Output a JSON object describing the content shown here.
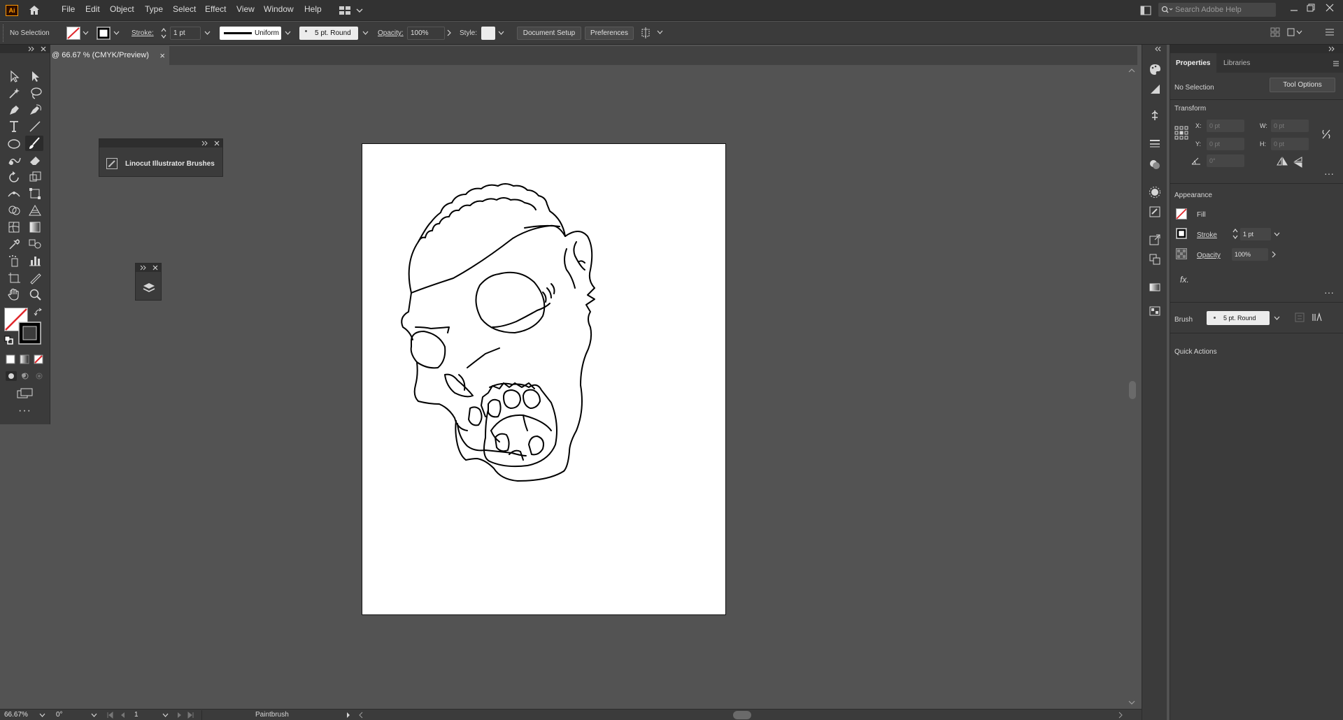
{
  "app": {
    "logo_text": "Ai",
    "menu": [
      "File",
      "Edit",
      "Object",
      "Type",
      "Select",
      "Effect",
      "View",
      "Window",
      "Help"
    ],
    "search_placeholder": "Search Adobe Help"
  },
  "controlbar": {
    "selection": "No Selection",
    "stroke_label": "Stroke:",
    "stroke_value": "1 pt",
    "profile": "Uniform",
    "brush": "5 pt. Round",
    "opacity_label": "Opacity:",
    "opacity_value": "100%",
    "style_label": "Style:",
    "document_setup": "Document Setup",
    "preferences": "Preferences"
  },
  "document_tab": {
    "title": "@ 66.67 % (CMYK/Preview)",
    "close": "×"
  },
  "brushes_panel": {
    "label": "Linocut Illustrator Brushes"
  },
  "properties": {
    "tab_properties": "Properties",
    "tab_libraries": "Libraries",
    "selection": "No Selection",
    "tool_options": "Tool Options",
    "transform_title": "Transform",
    "x_label": "X:",
    "y_label": "Y:",
    "w_label": "W:",
    "h_label": "H:",
    "x_value": "0 pt",
    "y_value": "0 pt",
    "w_value": "0 pt",
    "h_value": "0 pt",
    "angle_value": "0°",
    "appearance_title": "Appearance",
    "fill_label": "Fill",
    "stroke_label": "Stroke",
    "stroke_value": "1 pt",
    "opacity_label": "Opacity",
    "opacity_value": "100%",
    "fx_label": "fx.",
    "brush_label": "Brush",
    "brush_value": "5 pt. Round",
    "quick_actions": "Quick Actions"
  },
  "statusbar": {
    "zoom": "66.67%",
    "rotation": "0°",
    "artboard": "1",
    "tool": "Paintbrush"
  },
  "colors": {
    "accent": "#ff9a00",
    "none_slash": "#e0262b",
    "canvas_bg": "#535353",
    "panel_bg": "#3b3b3b"
  }
}
